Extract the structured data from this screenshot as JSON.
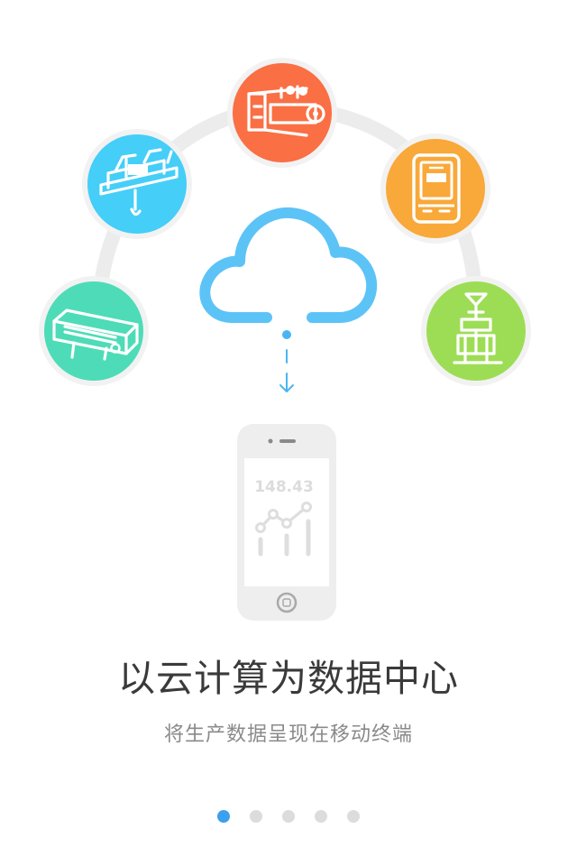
{
  "phone_screen": {
    "value": "148.43"
  },
  "headline": "以云计算为数据中心",
  "subheadline": "将生产数据呈现在移动终端",
  "pager": {
    "total": 5,
    "current": 1
  },
  "colors": {
    "crane_icon_bg": "#45cef7",
    "steel_mill_icon_bg": "#fa6f44",
    "meter_icon_bg": "#f9a83a",
    "conveyor_icon_bg": "#4ddcb7",
    "derrick_icon_bg": "#9ddd55",
    "cloud_stroke": "#5cc3f7",
    "pager_active": "#3aa0ef",
    "pager_inactive": "#dcdcdc"
  },
  "icons": [
    "overhead-crane-icon",
    "rolling-mill-icon",
    "electric-meter-icon",
    "conveyor-machine-icon",
    "drilling-rig-icon",
    "cloud-icon",
    "download-arrow-icon",
    "smartphone-icon",
    "line-chart-icon"
  ]
}
